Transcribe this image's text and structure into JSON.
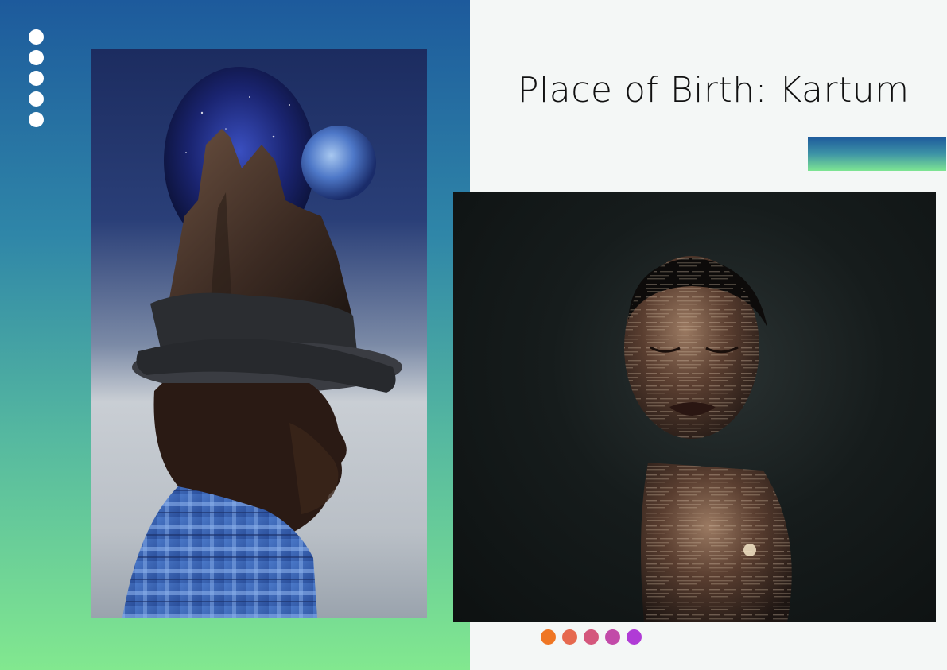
{
  "title": "Place of Birth: Kartum",
  "colors": {
    "panel_top": "#1d5a9c",
    "panel_bottom": "#82e88f",
    "accent_bar_top": "#1d5a9c",
    "accent_bar_bottom": "#7ee593",
    "dots_white": "#ffffff"
  },
  "decor": {
    "white_dots_count": 5,
    "color_dots": [
      "#ef7624",
      "#e6694f",
      "#d4577c",
      "#c24aa8",
      "#b03bd6"
    ]
  },
  "images": [
    {
      "id": "hat-man",
      "subject": "surreal portrait of man wearing hat with mountain and planet"
    },
    {
      "id": "newspaper-face",
      "subject": "portrait of woman with newspaper texture projected on skin"
    }
  ]
}
